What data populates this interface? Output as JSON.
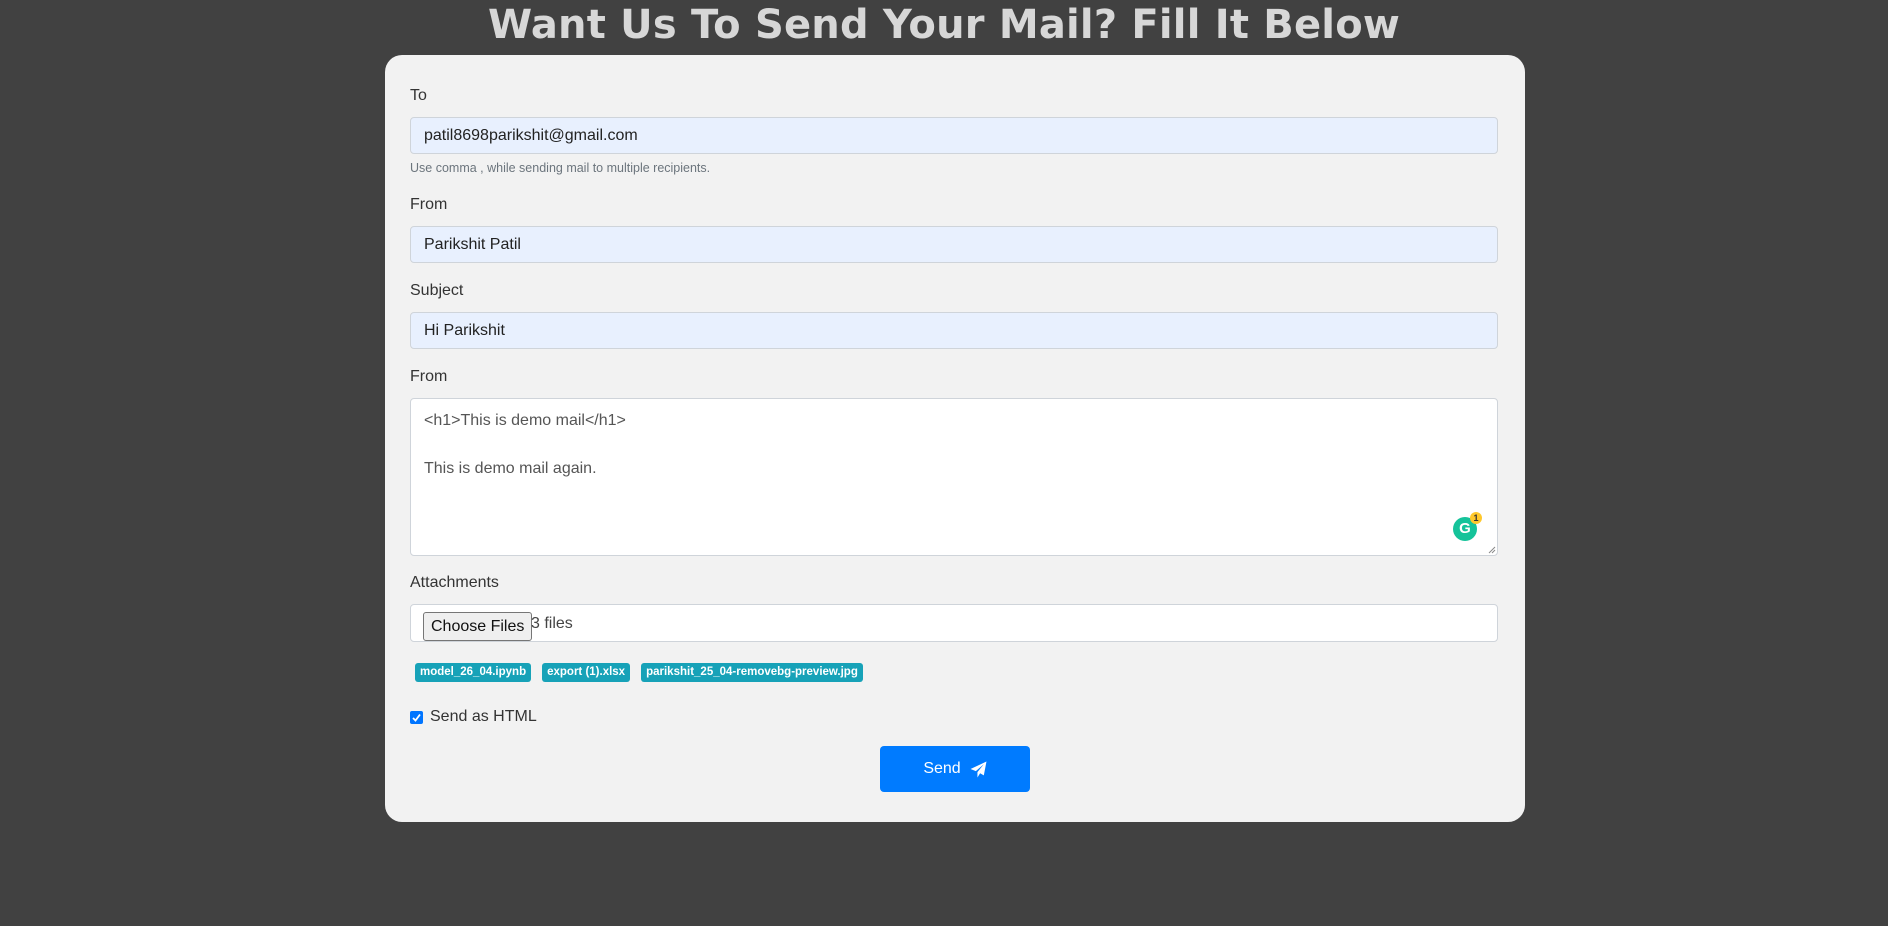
{
  "title": "Want Us To Send Your Mail? Fill It Below",
  "form": {
    "to": {
      "label": "To",
      "value": "patil8698parikshit@gmail.com",
      "hint": "Use comma , while sending mail to multiple recipients."
    },
    "from": {
      "label": "From",
      "value": "Parikshit Patil"
    },
    "subject": {
      "label": "Subject",
      "value": "Hi Parikshit"
    },
    "body": {
      "label": "From",
      "value": "<h1>This is demo mail</h1>\n\nThis is demo mail again."
    },
    "grammarly": {
      "letter": "G",
      "count": "1"
    },
    "attachments": {
      "label": "Attachments",
      "button_label": "Choose Files",
      "file_count": "3 files",
      "files": [
        "model_26_04.ipynb",
        "export (1).xlsx",
        "parikshit_25_04-removebg-preview.jpg"
      ]
    },
    "send_as_html": {
      "label": "Send as HTML",
      "checked": true
    },
    "send_button": {
      "label": "Send",
      "icon": "paper-plane-icon"
    }
  },
  "colors": {
    "page_background": "#414141",
    "card_background": "#f2f2f2",
    "primary": "#007bff",
    "chip": "#17a2b8",
    "autofill": "#e8f0fe"
  }
}
